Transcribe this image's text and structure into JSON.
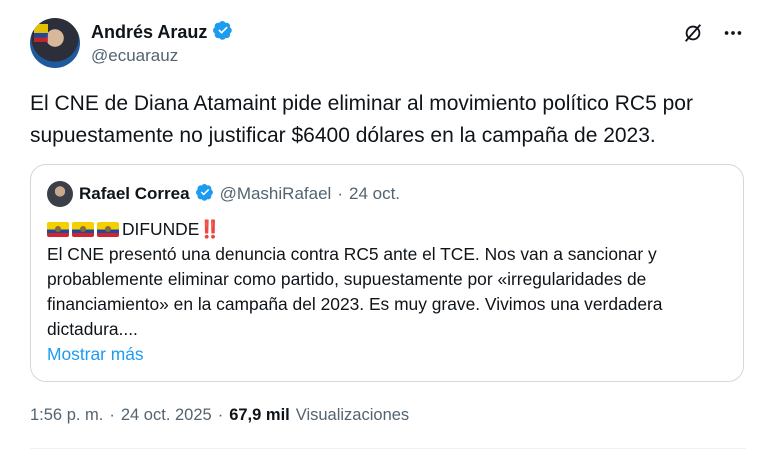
{
  "author": {
    "display_name": "Andrés Arauz",
    "handle": "@ecuarauz",
    "verified_icon": "verified-badge-icon"
  },
  "icons": {
    "grok": "grok-icon",
    "more": "more-icon"
  },
  "tweet": {
    "text": "El CNE de Diana Atamaint pide eliminar al movimiento político RC5 por supuestamente no justificar $6400 dólares en la campaña de 2023."
  },
  "quote": {
    "display_name": "Rafael Correa",
    "handle": "@MashiRafael",
    "separator": "·",
    "date": "24 oct.",
    "headline": "DIFUNDE",
    "headline_emoji": "‼️",
    "body": "El CNE presentó una denuncia contra RC5 ante el TCE. Nos van a sancionar y probablemente eliminar como partido, supuestamente por «irregularidades de financiamiento» en la campaña del 2023. Es muy grave. Vivimos una verdadera dictadura....",
    "show_more": "Mostrar más"
  },
  "footer": {
    "time": "1:56 p. m.",
    "sep1": "·",
    "date": "24 oct. 2025",
    "sep2": "·",
    "views_count": "67,9 mil",
    "views_label": "Visualizaciones"
  },
  "colors": {
    "verified": "#1d9bf0",
    "link": "#1d9bf0",
    "secondary_text": "#536471",
    "border": "#cfd9de"
  }
}
